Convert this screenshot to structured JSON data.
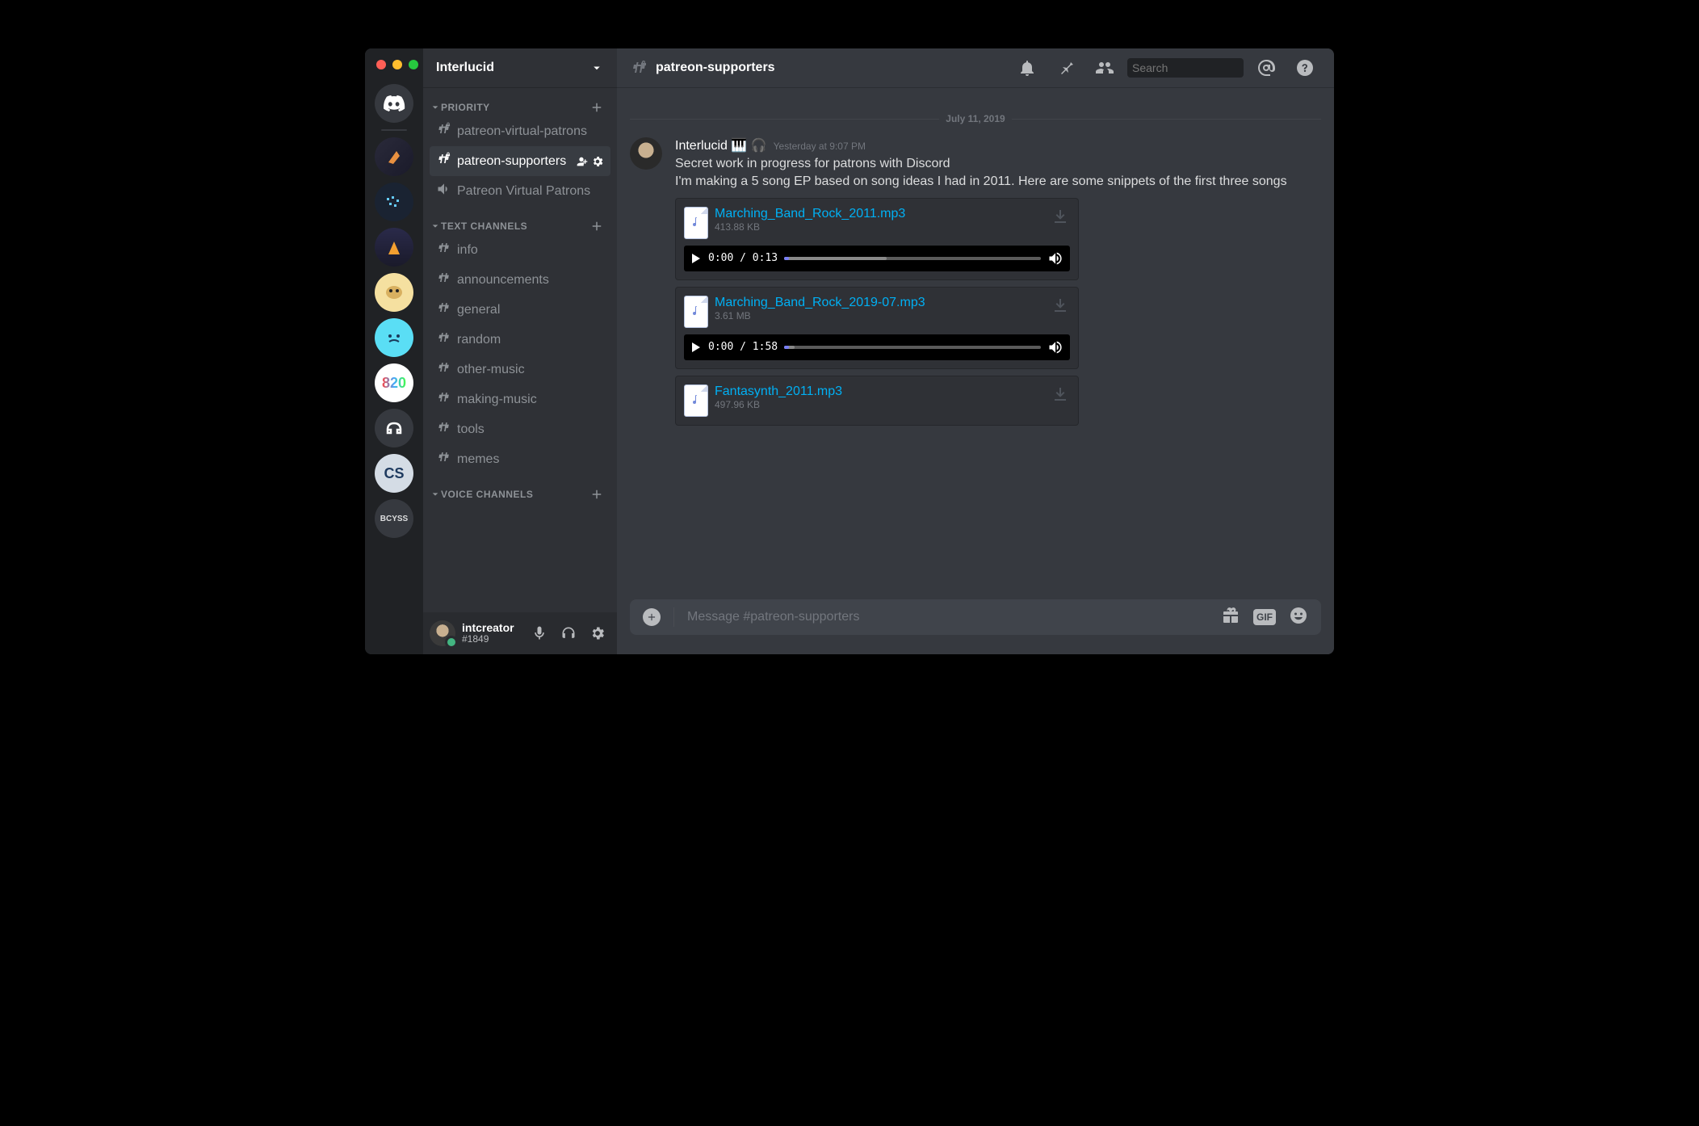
{
  "server_name": "Interlucid",
  "categories": [
    {
      "name": "PRIORITY",
      "channels": [
        {
          "type": "text-locked",
          "name": "patreon-virtual-patrons",
          "selected": false
        },
        {
          "type": "text-locked",
          "name": "patreon-supporters",
          "selected": true
        },
        {
          "type": "voice",
          "name": "Patreon Virtual Patrons",
          "selected": false
        }
      ]
    },
    {
      "name": "TEXT CHANNELS",
      "channels": [
        {
          "type": "text",
          "name": "info"
        },
        {
          "type": "text",
          "name": "announcements"
        },
        {
          "type": "text",
          "name": "general"
        },
        {
          "type": "text",
          "name": "random"
        },
        {
          "type": "text",
          "name": "other-music"
        },
        {
          "type": "text",
          "name": "making-music"
        },
        {
          "type": "text",
          "name": "tools"
        },
        {
          "type": "text",
          "name": "memes"
        }
      ]
    },
    {
      "name": "VOICE CHANNELS",
      "channels": []
    }
  ],
  "user": {
    "name": "intcreator",
    "tag": "#1849"
  },
  "channel_title": "patreon-supporters",
  "search_placeholder": "Search",
  "date_divider": "July 11, 2019",
  "message": {
    "author": "Interlucid 🎹 🎧",
    "timestamp": "Yesterday at 9:07 PM",
    "line1": "Secret work in progress for patrons with Discord",
    "line2": "I'm making a 5 song EP based on song ideas I had in 2011.  Here are some snippets of the first three songs"
  },
  "attachments": [
    {
      "name": "Marching_Band_Rock_2011.mp3",
      "size": "413.88 KB",
      "cur": "0:00",
      "dur": "0:13",
      "buf": 40,
      "pos": 2,
      "player": true
    },
    {
      "name": "Marching_Band_Rock_2019-07.mp3",
      "size": "3.61 MB",
      "cur": "0:00",
      "dur": "1:58",
      "buf": 4,
      "pos": 2,
      "player": true
    },
    {
      "name": "Fantasynth_2011.mp3",
      "size": "497.96 KB",
      "player": false
    }
  ],
  "input_placeholder": "Message #patreon-supporters",
  "gif_label": "GIF",
  "server_820": "820",
  "server_bcyss": "BCYSS",
  "server_cs": "CS"
}
